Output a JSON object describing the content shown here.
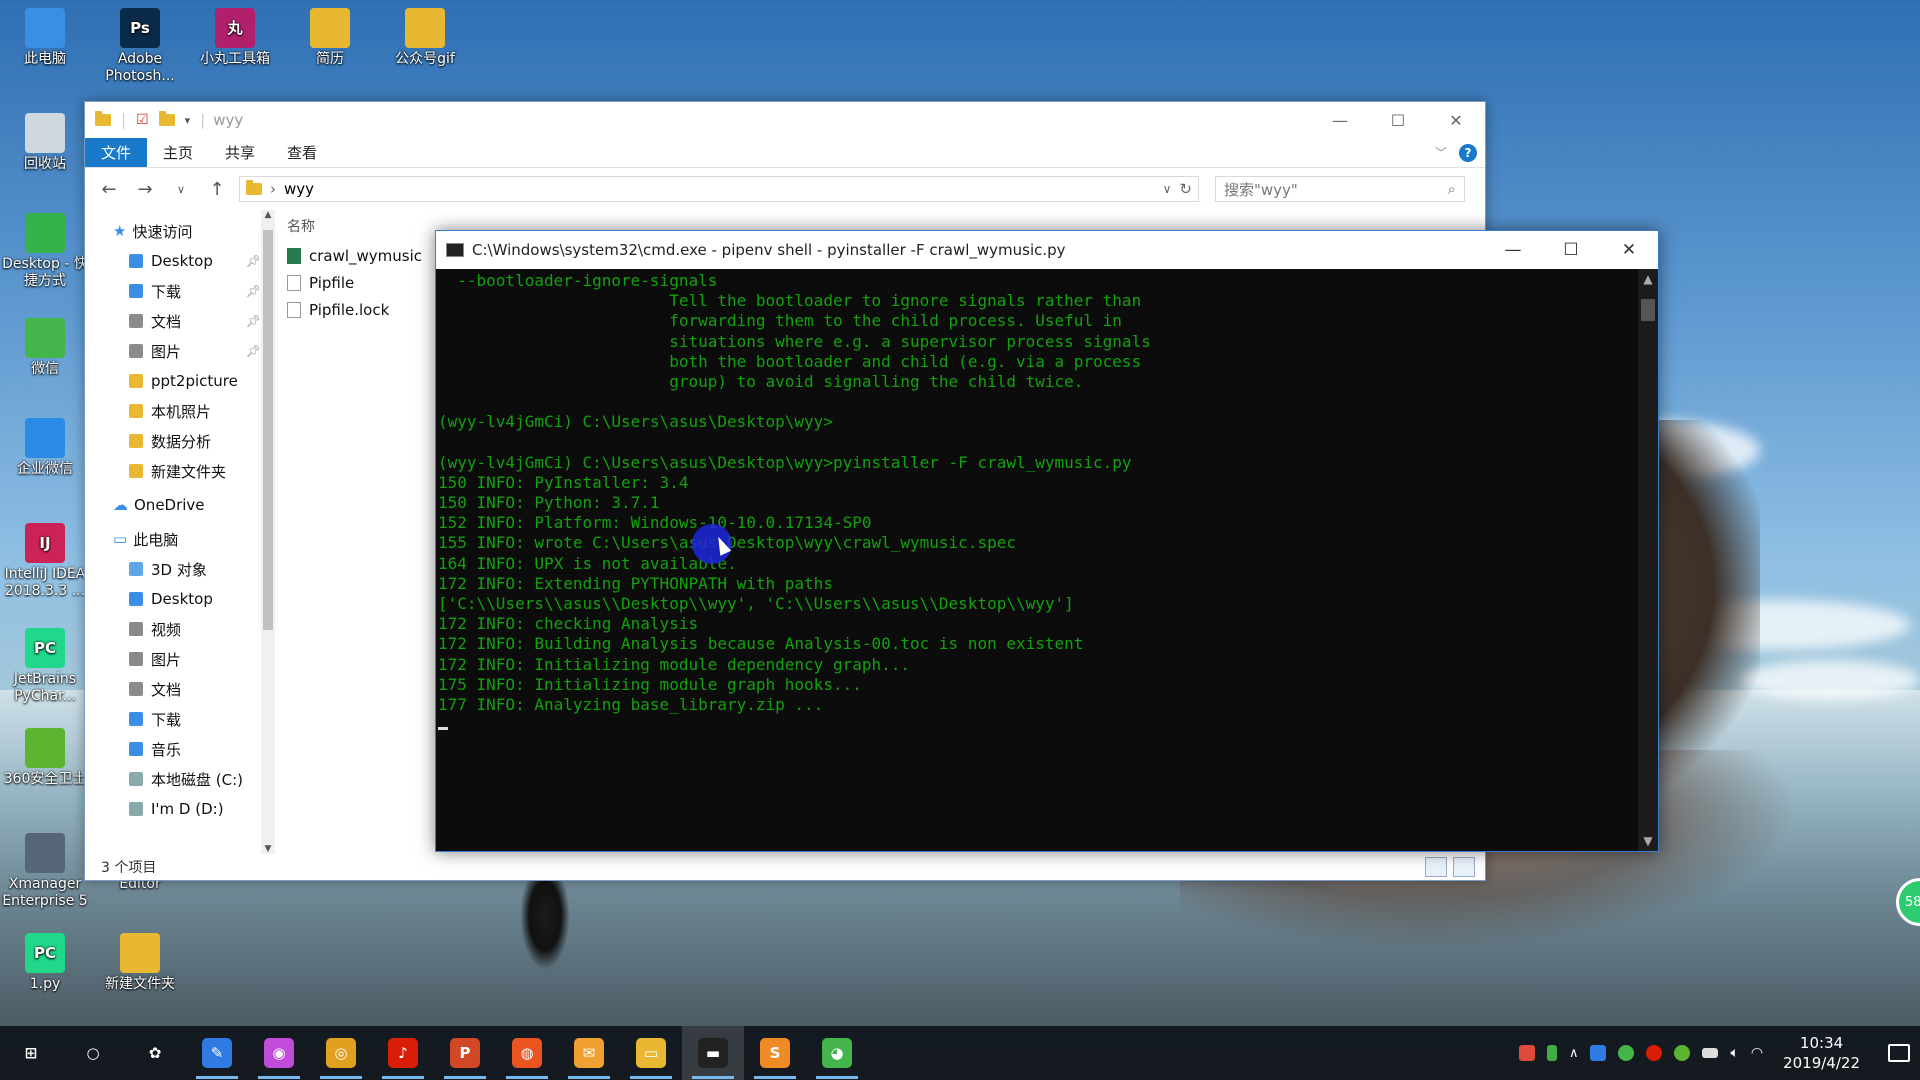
{
  "desktop": {
    "icons": [
      {
        "label": "此电脑",
        "icon": "computer-icon",
        "color": "#3a8ee6"
      },
      {
        "label": "Adobe Photosh...",
        "icon": "photoshop-icon",
        "color": "#0b2a4a",
        "glyph": "Ps"
      },
      {
        "label": "小丸工具箱",
        "icon": "toolbox-icon",
        "color": "#b0206d",
        "glyph": "丸"
      },
      {
        "label": "简历",
        "icon": "folder-icon",
        "color": "#e8b833"
      },
      {
        "label": "公众号gif",
        "icon": "folder-icon",
        "color": "#e8b833"
      },
      {
        "label": "回收站",
        "icon": "recycle-bin-icon",
        "color": "#cfd8df"
      },
      {
        "label": "Desktop - 快捷方式",
        "icon": "shortcut-icon",
        "color": "#36b24a"
      },
      {
        "label": "微信",
        "icon": "wechat-icon",
        "color": "#43b54a"
      },
      {
        "label": "企业微信",
        "icon": "work-wechat-icon",
        "color": "#2b8be6"
      },
      {
        "label": "IntelliJ IDEA 2018.3.3 ...",
        "icon": "intellij-icon",
        "color": "#cc2255",
        "glyph": "IJ"
      },
      {
        "label": "JetBrains PyChar...",
        "icon": "pycharm-icon",
        "color": "#21d789",
        "glyph": "PC"
      },
      {
        "label": "360安全卫士",
        "icon": "360-icon",
        "color": "#5cb531"
      },
      {
        "label": "Xmanager Enterprise 5",
        "icon": "xmanager-icon",
        "color": "#556677"
      },
      {
        "label": "Editor",
        "icon": "editor-icon",
        "color": "#5a7bd6"
      },
      {
        "label": "1.py",
        "icon": "pycharm-file-icon",
        "color": "#21d789",
        "glyph": "PC"
      },
      {
        "label": "新建文件夹",
        "icon": "folder-icon",
        "color": "#e8b833"
      }
    ]
  },
  "explorer": {
    "title": "wyy",
    "ribbon_tabs": [
      "文件",
      "主页",
      "共享",
      "查看"
    ],
    "help": "?",
    "address": "wyy",
    "search_placeholder": "搜索\"wyy\"",
    "nav": {
      "quick_access": "快速访问",
      "items": [
        {
          "label": "Desktop",
          "pinned": true,
          "color": "#3a8ee6"
        },
        {
          "label": "下载",
          "pinned": true,
          "color": "#3a8ee6"
        },
        {
          "label": "文档",
          "pinned": true,
          "color": "#8a8a8a"
        },
        {
          "label": "图片",
          "pinned": true,
          "color": "#8a8a8a"
        },
        {
          "label": "ppt2picture",
          "pinned": false,
          "color": "#e8b833"
        },
        {
          "label": "本机照片",
          "pinned": false,
          "color": "#e8b833"
        },
        {
          "label": "数据分析",
          "pinned": false,
          "color": "#e8b833"
        },
        {
          "label": "新建文件夹",
          "pinned": false,
          "color": "#e8b833"
        }
      ],
      "onedrive": "OneDrive",
      "this_pc": "此电脑",
      "pc_items": [
        {
          "label": "3D 对象"
        },
        {
          "label": "Desktop"
        },
        {
          "label": "视频"
        },
        {
          "label": "图片"
        },
        {
          "label": "文档"
        },
        {
          "label": "下载"
        },
        {
          "label": "音乐"
        },
        {
          "label": "本地磁盘 (C:)"
        },
        {
          "label": "I'm D (D:)"
        }
      ]
    },
    "column_header": "名称",
    "files": [
      {
        "name": "crawl_wymusic",
        "type": "py"
      },
      {
        "name": "Pipfile",
        "type": "file"
      },
      {
        "name": "Pipfile.lock",
        "type": "file"
      }
    ],
    "status": "3 个项目"
  },
  "cmd": {
    "title": "C:\\Windows\\system32\\cmd.exe - pipenv  shell - pyinstaller  -F crawl_wymusic.py",
    "lines": [
      "  --bootloader-ignore-signals",
      "                        Tell the bootloader to ignore signals rather than",
      "                        forwarding them to the child process. Useful in",
      "                        situations where e.g. a supervisor process signals",
      "                        both the bootloader and child (e.g. via a process",
      "                        group) to avoid signalling the child twice.",
      "",
      "(wyy-lv4jGmCi) C:\\Users\\asus\\Desktop\\wyy>",
      "",
      "(wyy-lv4jGmCi) C:\\Users\\asus\\Desktop\\wyy>pyinstaller -F crawl_wymusic.py",
      "150 INFO: PyInstaller: 3.4",
      "150 INFO: Python: 3.7.1",
      "152 INFO: Platform: Windows-10-10.0.17134-SP0",
      "155 INFO: wrote C:\\Users\\asus\\Desktop\\wyy\\crawl_wymusic.spec",
      "164 INFO: UPX is not available.",
      "172 INFO: Extending PYTHONPATH with paths",
      "['C:\\\\Users\\\\asus\\\\Desktop\\\\wyy', 'C:\\\\Users\\\\asus\\\\Desktop\\\\wyy']",
      "172 INFO: checking Analysis",
      "172 INFO: Building Analysis because Analysis-00.toc is non existent",
      "172 INFO: Initializing module dependency graph...",
      "175 INFO: Initializing module graph hooks...",
      "177 INFO: Analyzing base_library.zip ..."
    ],
    "text_color": "#13a10e"
  },
  "side_badge": "58",
  "taskbar": {
    "apps": [
      {
        "name": "start-button",
        "glyph": "⊞",
        "color": "transparent"
      },
      {
        "name": "cortana-button",
        "glyph": "○",
        "color": "transparent"
      },
      {
        "name": "baidu-netdisk-app",
        "glyph": "✿",
        "color": "transparent"
      },
      {
        "name": "feishu-app",
        "glyph": "✎",
        "color": "#2f7be3"
      },
      {
        "name": "color-app",
        "glyph": "◉",
        "color": "#c04cd9"
      },
      {
        "name": "chrome-app",
        "glyph": "◎",
        "color": "#e0a020"
      },
      {
        "name": "netease-music-app",
        "glyph": "♪",
        "color": "#d81e06"
      },
      {
        "name": "ppt-app",
        "glyph": "P",
        "color": "#d24726"
      },
      {
        "name": "ubuntu-app",
        "glyph": "◍",
        "color": "#e95420"
      },
      {
        "name": "notepad-app",
        "glyph": "✉",
        "color": "#f0a030"
      },
      {
        "name": "file-explorer-app",
        "glyph": "▭",
        "color": "#e8b833"
      },
      {
        "name": "cmd-app",
        "glyph": "▬",
        "color": "#222222"
      },
      {
        "name": "sublime-app",
        "glyph": "S",
        "color": "#f08a24"
      },
      {
        "name": "wechat-app",
        "glyph": "◕",
        "color": "#43b54a"
      }
    ],
    "time": "10:34",
    "date": "2019/4/22"
  }
}
